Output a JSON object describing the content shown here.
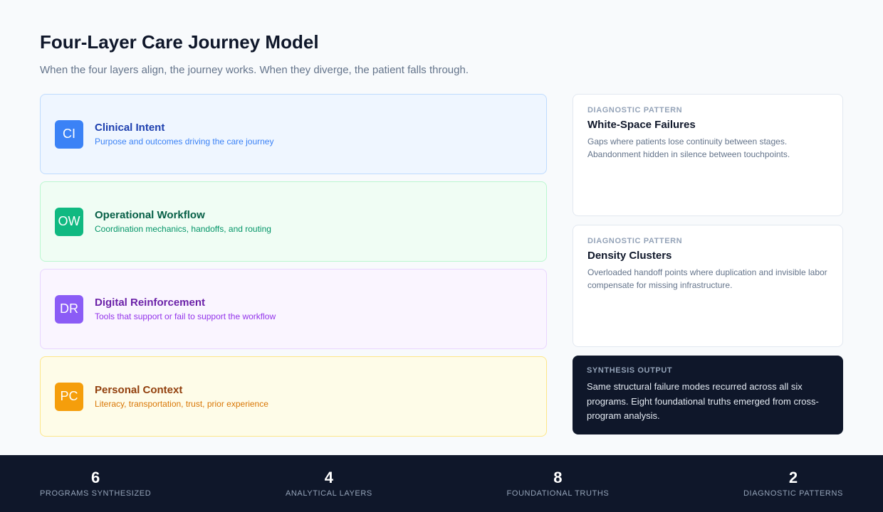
{
  "header": {
    "title": "Four-Layer Care Journey Model",
    "subtitle": "When the four layers align, the journey works. When they diverge, the patient falls through."
  },
  "layers": [
    {
      "badge": "CI",
      "title": "Clinical Intent",
      "description": "Purpose and outcomes driving the care journey",
      "color": "#3b82f6"
    },
    {
      "badge": "OW",
      "title": "Operational Workflow",
      "description": "Coordination mechanics, handoffs, and routing",
      "color": "#10b981"
    },
    {
      "badge": "DR",
      "title": "Digital Reinforcement",
      "description": "Tools that support or fail to support the workflow",
      "color": "#8b5cf6"
    },
    {
      "badge": "PC",
      "title": "Personal Context",
      "description": "Literacy, transportation, trust, prior experience",
      "color": "#f59e0b"
    }
  ],
  "patterns": [
    {
      "eyebrow": "DIAGNOSTIC PATTERN",
      "title": "White-Space Failures",
      "description": "Gaps where patients lose continuity between stages. Abandonment hidden in silence between touchpoints."
    },
    {
      "eyebrow": "DIAGNOSTIC PATTERN",
      "title": "Density Clusters",
      "description": "Overloaded handoff points where duplication and invisible labor compensate for missing infrastructure."
    }
  ],
  "synthesis": {
    "eyebrow": "SYNTHESIS OUTPUT",
    "description": "Same structural failure modes recurred across all six programs. Eight foundational truths emerged from cross-program analysis."
  },
  "stats": [
    {
      "value": "6",
      "label": "PROGRAMS SYNTHESIZED"
    },
    {
      "value": "4",
      "label": "ANALYTICAL LAYERS"
    },
    {
      "value": "8",
      "label": "FOUNDATIONAL TRUTHS"
    },
    {
      "value": "2",
      "label": "DIAGNOSTIC PATTERNS"
    }
  ]
}
